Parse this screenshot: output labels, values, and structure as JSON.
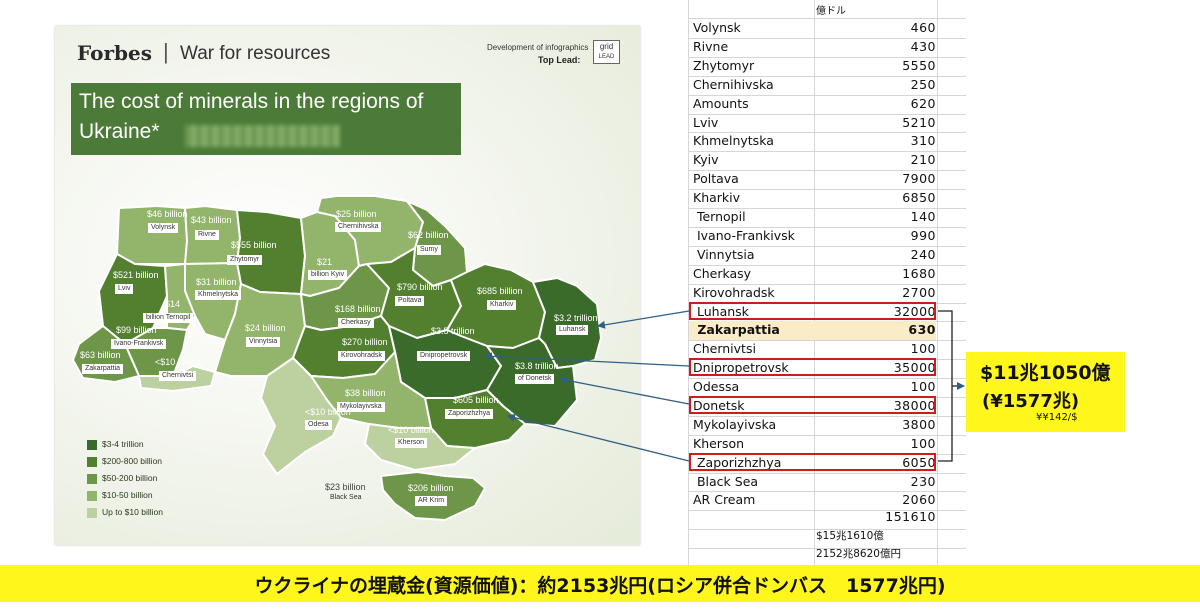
{
  "colors": {
    "c1": "#3b6b2a",
    "c2": "#52802f",
    "c3": "#6e9648",
    "c4": "#93b46b",
    "c5": "#bdd1a0",
    "highlight_red": "#d21a1a",
    "callout_yellow": "#fff71c",
    "arrow_blue": "#2f5f88"
  },
  "map": {
    "brand": "Forbes",
    "subtitle": "War for resources",
    "credit_line1": "Development of infographics",
    "credit_line2": "Top Lead:",
    "credit_logo_top": "grid",
    "credit_logo_bottom": "LEAD",
    "title_line1": "The cost of minerals in the regions of",
    "title_line2": "Ukraine*",
    "regions": {
      "volynsk": {
        "value": "$46 billion",
        "name": "Volynsk",
        "class": "c4"
      },
      "rivne": {
        "value": "$43 billion",
        "name": "Rivne",
        "class": "c4"
      },
      "zhytomyr": {
        "value": "$555 billion",
        "name": "Zhytomyr",
        "class": "c2"
      },
      "kyiv": {
        "value": "$21",
        "name": "billion Kyiv",
        "class": "c4"
      },
      "chernihivska": {
        "value": "$25 billion",
        "name": "Chernihivska",
        "class": "c4"
      },
      "sumy": {
        "value": "$62 billion",
        "name": "Sumy",
        "class": "c3"
      },
      "lviv": {
        "value": "$521 billion",
        "name": "Lviv",
        "class": "c2"
      },
      "khmelnytska": {
        "value": "$31 billion",
        "name": "Khmelnytska",
        "class": "c4"
      },
      "ternopil": {
        "value": "$14",
        "name": "billion Ternopil",
        "class": "c4"
      },
      "ivano_frankivsk": {
        "value": "$99 billion",
        "name": "Ivano-Frankivsk",
        "class": "c3"
      },
      "zakarpattia": {
        "value": "$63 billion",
        "name": "Zakarpattia",
        "class": "c3"
      },
      "chernivtsi": {
        "value": "<$10 billion",
        "name": "Chernivtsi",
        "class": "c5"
      },
      "vinnytsia": {
        "value": "$24 billion",
        "name": "Vinnytsia",
        "class": "c4"
      },
      "cherkasy": {
        "value": "$168 billion",
        "name": "Cherkasy",
        "class": "c3"
      },
      "poltava": {
        "value": "$790 billion",
        "name": "Poltava",
        "class": "c2"
      },
      "kharkiv": {
        "value": "$685 billion",
        "name": "Kharkiv",
        "class": "c2"
      },
      "luhansk": {
        "value": "$3.2 trillion",
        "name": "Luhansk",
        "class": "c1"
      },
      "kirovohradsk": {
        "value": "$270 billion",
        "name": "Kirovohradsk",
        "class": "c2"
      },
      "dnipropetrovsk": {
        "value": "$3.5 trillion",
        "name": "Dnipropetrovsk",
        "class": "c1"
      },
      "donetsk": {
        "value": "$3.8 trillion",
        "name": "of Donetsk",
        "class": "c1"
      },
      "mykolayivska": {
        "value": "$38 billion",
        "name": "Mykolayivska",
        "class": "c4"
      },
      "odesa": {
        "value": "<$10 billion",
        "name": "Odesa",
        "class": "c5"
      },
      "kherson": {
        "value": "<$10 billion",
        "name": "Kherson",
        "class": "c5"
      },
      "zaporizhzhya": {
        "value": "$605 billion",
        "name": "Zaporizhzhya",
        "class": "c2"
      },
      "black_sea": {
        "value": "$23 billion",
        "name": "Black Sea",
        "class": "none"
      },
      "crimea": {
        "value": "$206 billion",
        "name": "AR Krim",
        "class": "c3"
      }
    },
    "legend": [
      {
        "label": "$3-4 trillion",
        "color": "#3b6b2a"
      },
      {
        "label": "$200-800 billion",
        "color": "#52802f"
      },
      {
        "label": "$50-200 billion",
        "color": "#6e9648"
      },
      {
        "label": "$10-50 billion",
        "color": "#93b46b"
      },
      {
        "label": "Up to $10 billion",
        "color": "#bdd1a0"
      }
    ]
  },
  "table": {
    "unit": "億ドル",
    "rows": [
      {
        "name": "Volynsk",
        "value": "460"
      },
      {
        "name": "Rivne",
        "value": "430"
      },
      {
        "name": "Zhytomyr",
        "value": "5550"
      },
      {
        "name": "Chernihivska",
        "value": "250"
      },
      {
        "name": "Amounts",
        "value": "620"
      },
      {
        "name": "Lviv",
        "value": "5210"
      },
      {
        "name": "Khmelnytska",
        "value": "310"
      },
      {
        "name": "Kyiv",
        "value": "210"
      },
      {
        "name": "Poltava",
        "value": "7900"
      },
      {
        "name": "Kharkiv",
        "value": "6850"
      },
      {
        "name": " Ternopil",
        "value": "140"
      },
      {
        "name": " Ivano-Frankivsk",
        "value": "990"
      },
      {
        "name": " Vinnytsia",
        "value": "240"
      },
      {
        "name": "Cherkasy",
        "value": "1680"
      },
      {
        "name": "Kirovohradsk",
        "value": "2700"
      },
      {
        "name": " Luhansk",
        "value": "32000"
      },
      {
        "name": " Zakarpattia",
        "value": "630"
      },
      {
        "name": "Chernivtsi",
        "value": "100"
      },
      {
        "name": "Dnipropetrovsk",
        "value": "35000"
      },
      {
        "name": "Odessa",
        "value": "100"
      },
      {
        "name": "Donetsk",
        "value": "38000"
      },
      {
        "name": "Mykolayivska",
        "value": "3800"
      },
      {
        "name": "Kherson",
        "value": "100"
      },
      {
        "name": " Zaporizhzhya",
        "value": "6050"
      },
      {
        "name": " Black Sea",
        "value": "230"
      },
      {
        "name": "AR Cream",
        "value": "2060"
      }
    ],
    "total": "151610",
    "total_usd": "$15兆1610億",
    "total_yen": "2152兆8620億円"
  },
  "callout": {
    "line1": "$11兆1050億",
    "line2": "(¥1577兆)",
    "rate": "¥¥142/$"
  },
  "banner": "ウクライナの埋蔵金(資源価値)：約2153兆円(ロシア併合ドンバス　1577兆円)"
}
